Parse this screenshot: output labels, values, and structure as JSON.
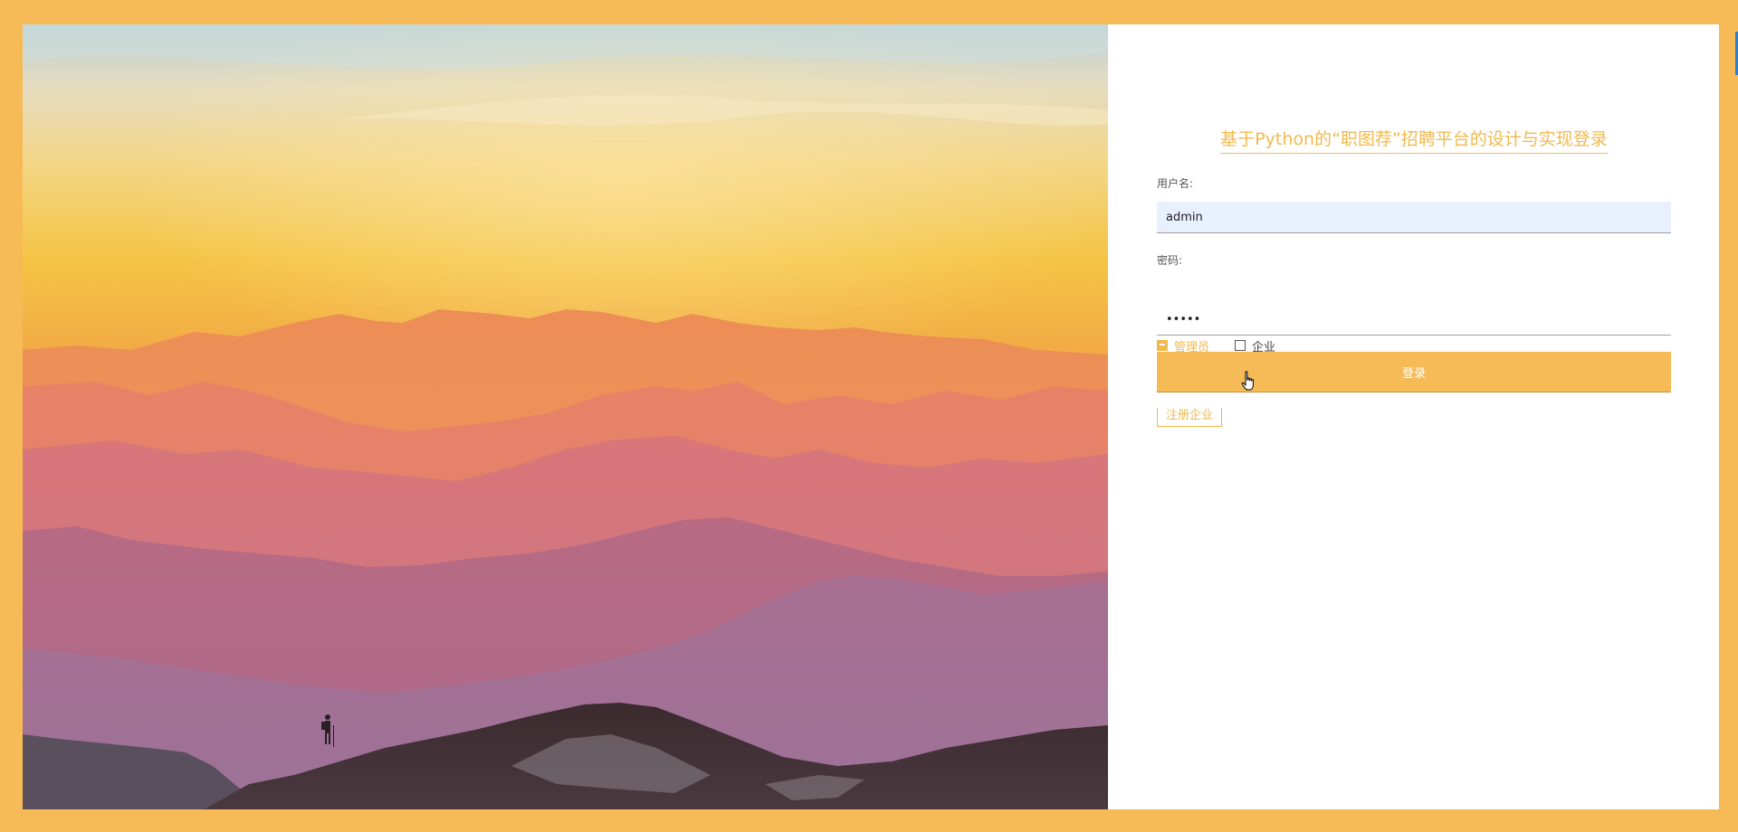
{
  "login": {
    "title": "基于Python的“职图荐”招聘平台的设计与实现登录",
    "username_label": "用户名:",
    "username_value": "admin",
    "password_label": "密码:",
    "password_value": "•••••",
    "roles": [
      {
        "label": "管理员",
        "checked": true
      },
      {
        "label": "企业",
        "checked": false
      }
    ],
    "submit_label": "登录",
    "register_label": "注册企业"
  },
  "colors": {
    "accent": "#f6bb56",
    "accent_text": "#f1b94d",
    "frame": "#f6bb56",
    "autofill_bg": "#e8f0fe"
  },
  "icons": {
    "cursor": "hand-pointer-icon"
  }
}
